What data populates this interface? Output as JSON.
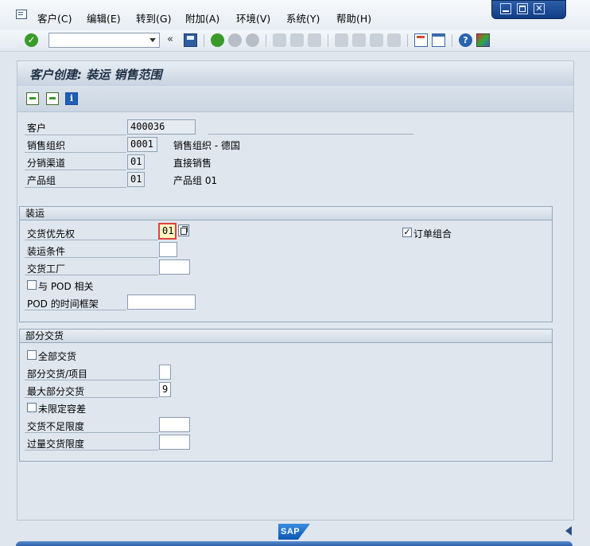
{
  "menu": {
    "items": [
      "客户(C)",
      "编辑(E)",
      "转到(G)",
      "附加(A)",
      "环境(V)",
      "系统(Y)",
      "帮助(H)"
    ]
  },
  "toolbar": {
    "command_value": "",
    "icons": [
      "ok-icon",
      "command-dropdown",
      "save-icon",
      "back-icon",
      "exit-icon",
      "cancel-icon",
      "print-icon",
      "find-icon",
      "find-next-icon",
      "first-page-icon",
      "prev-page-icon",
      "next-page-icon",
      "last-page-icon",
      "create-session-icon",
      "shortcut-icon",
      "help-icon",
      "layout-icon"
    ]
  },
  "page": {
    "title": "客户创建: 装运 销售范围"
  },
  "header_fields": {
    "customer_label": "客户",
    "customer_value": "400036",
    "sales_org_label": "销售组织",
    "sales_org_value": "0001",
    "sales_org_desc": "销售组织 - 德国",
    "dist_channel_label": "分销渠道",
    "dist_channel_value": "01",
    "dist_channel_desc": "直接销售",
    "division_label": "产品组",
    "division_value": "01",
    "division_desc": "产品组 01"
  },
  "shipping": {
    "title": "装运",
    "delivery_priority_label": "交货优先权",
    "delivery_priority_value": "01",
    "order_combination_label": "订单组合",
    "order_combination_checked": true,
    "shipping_conditions_label": "装运条件",
    "shipping_conditions_value": "",
    "delivering_plant_label": "交货工厂",
    "delivering_plant_value": "",
    "pod_relevant_label": "与 POD 相关",
    "pod_relevant_checked": false,
    "pod_timeframe_label": "POD 的时间框架",
    "pod_timeframe_value": ""
  },
  "partial_delivery": {
    "title": "部分交货",
    "complete_delivery_label": "全部交货",
    "complete_delivery_checked": false,
    "partial_per_item_label": "部分交货/项目",
    "partial_per_item_value": "",
    "max_partial_label": "最大部分交货",
    "max_partial_value": "9",
    "unlimited_tolerance_label": "未限定容差",
    "unlimited_tolerance_checked": false,
    "underdelivery_label": "交货不足限度",
    "underdelivery_value": "",
    "overdelivery_label": "过量交货限度",
    "overdelivery_value": ""
  },
  "footer": {
    "logo_text": "SAP"
  }
}
